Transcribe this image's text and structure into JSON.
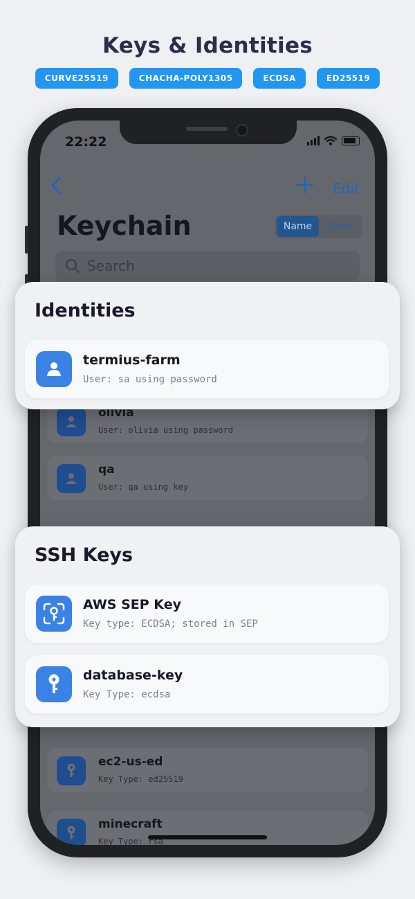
{
  "headline": "Keys & Identities",
  "tags": [
    "CURVE25519",
    "CHACHA-POLY1305",
    "ECDSA",
    "ED25519"
  ],
  "status": {
    "time": "22:22"
  },
  "nav": {
    "back_icon": "chevron-left-icon",
    "add_icon": "plus-icon",
    "edit_label": "Edit"
  },
  "page_title": "Keychain",
  "sort": {
    "name_label": "Name",
    "date_label": "Date",
    "selected": "Name"
  },
  "search": {
    "placeholder": "Search"
  },
  "background_identities": [
    {
      "name": "olivia",
      "detail": "User: olivia using password"
    },
    {
      "name": "qa",
      "detail": "User: qa using key"
    }
  ],
  "background_keys": [
    {
      "name": "ec2-us-ed",
      "detail": "Key Type: ed25519"
    },
    {
      "name": "minecraft",
      "detail": "Key Type: rsa"
    }
  ],
  "identities_section": {
    "title": "Identities",
    "items": [
      {
        "name": "termius-farm",
        "detail": "User: sa using password",
        "icon": "user-icon"
      }
    ]
  },
  "ssh_keys_section": {
    "title": "SSH Keys",
    "items": [
      {
        "name": "AWS SEP Key",
        "detail": "Key type: ECDSA; stored in SEP",
        "icon": "secure-enclave-key-icon"
      },
      {
        "name": "database-key",
        "detail": "Key Type: ecdsa",
        "icon": "key-icon"
      }
    ]
  },
  "colors": {
    "accent": "#2196f3",
    "icon_blue": "#3b82e6",
    "tint": "#2563b8"
  }
}
